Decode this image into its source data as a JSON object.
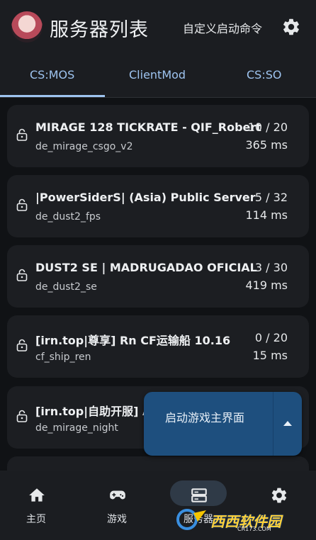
{
  "header": {
    "title": "服务器列表",
    "custom_command": "自定义启动命令"
  },
  "tabs": [
    {
      "label": "CS:MOS",
      "active": true
    },
    {
      "label": "ClientMod",
      "active": false
    },
    {
      "label": "CS:SO",
      "active": false
    }
  ],
  "servers": [
    {
      "name": "MIRAGE 128 TICKRATE - QIF_Robert",
      "map": "de_mirage_csgo_v2",
      "players": "10 / 20",
      "ping": "365 ms"
    },
    {
      "name": "|PowerSiderS| (Asia) Public Server",
      "map": "de_dust2_fps",
      "players": "5 / 32",
      "ping": "114 ms"
    },
    {
      "name": "DUST2 SE | MADRUGADAO OFICIAL",
      "map": "de_dust2_se",
      "players": "3 / 30",
      "ping": "419 ms"
    },
    {
      "name": "[irn.top|尊享] Rn CF运输船 10.16",
      "map": "cf_ship_ren",
      "players": "0 / 20",
      "ping": "15 ms"
    },
    {
      "name": "[irn.top|自助开服] A",
      "map": "de_mirage_night",
      "players": "",
      "ping": ""
    }
  ],
  "launch_button": {
    "label": "启动游戏主界面"
  },
  "bottom_nav": [
    {
      "label": "主页",
      "icon": "home-icon"
    },
    {
      "label": "游戏",
      "icon": "gamepad-icon"
    },
    {
      "label": "服务器",
      "icon": "server-icon",
      "active": true
    },
    {
      "label": "",
      "icon": "settings-icon"
    }
  ],
  "watermark": {
    "text": "西西软件园",
    "sub": "CR173.COM"
  },
  "colors": {
    "background": "#101215",
    "surface": "#1b1d21",
    "card": "#1c1e22",
    "accent": "#9ec4f0",
    "launch_button": "#1e4f7e"
  }
}
